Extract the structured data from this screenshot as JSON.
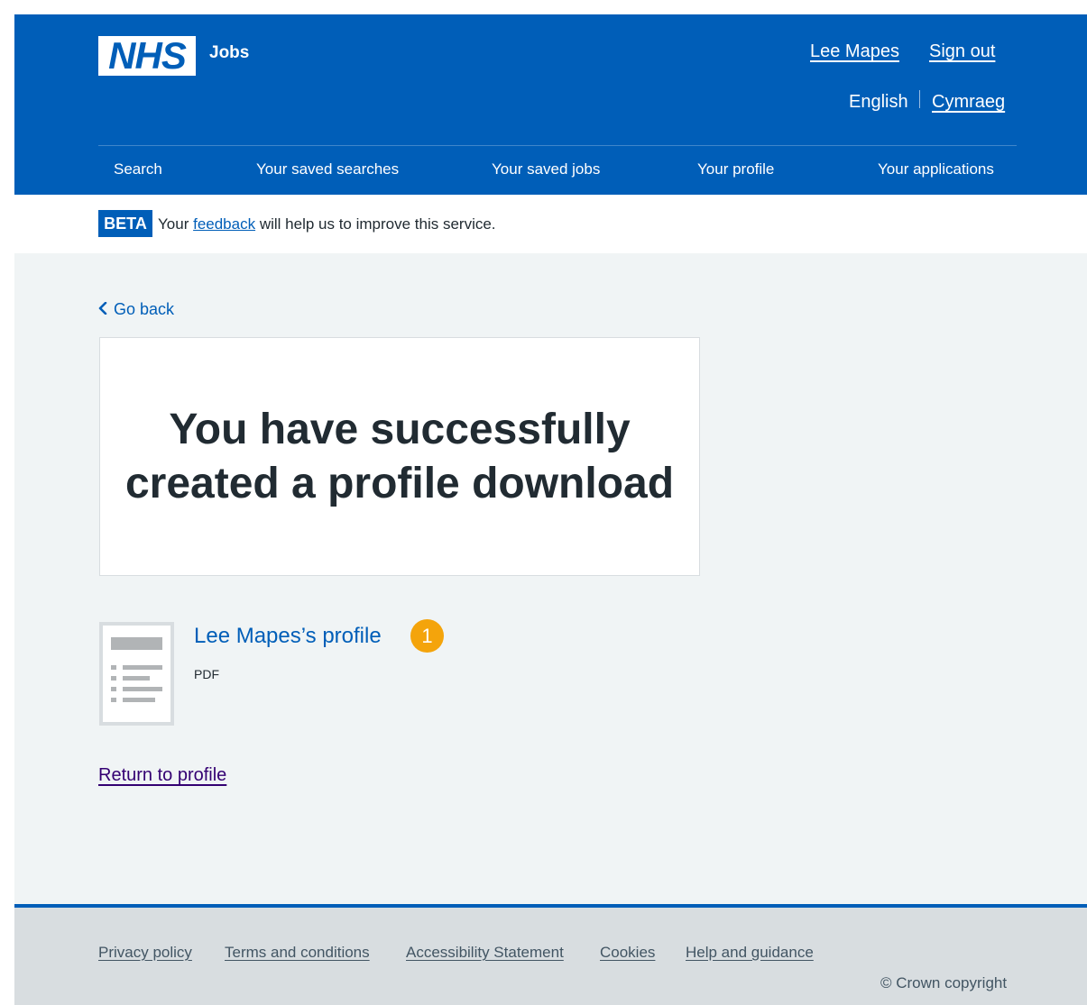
{
  "header": {
    "logo_text": "NHS",
    "service_name": "Jobs",
    "user_name": "Lee Mapes",
    "sign_out": "Sign out",
    "lang_current": "English",
    "lang_other": "Cymraeg",
    "brand_color": "#005eb8"
  },
  "nav": {
    "items": [
      "Search",
      "Your saved searches",
      "Your saved jobs",
      "Your profile",
      "Your applications"
    ]
  },
  "beta": {
    "tag": "BETA",
    "text_before": "Your",
    "link": "feedback",
    "text_after": "will help us to improve this service."
  },
  "main": {
    "back_link": "Go back",
    "panel_title": "You have successfully created a profile download",
    "file": {
      "name": "Lee Mapes’s profile",
      "type": "PDF",
      "badge": "1",
      "icon": "document-thumbnail-icon"
    },
    "return_link": "Return to profile"
  },
  "footer": {
    "links": [
      "Privacy policy",
      "Terms and conditions",
      "Accessibility Statement",
      "Cookies",
      "Help and guidance"
    ],
    "copyright": "© Crown copyright"
  }
}
